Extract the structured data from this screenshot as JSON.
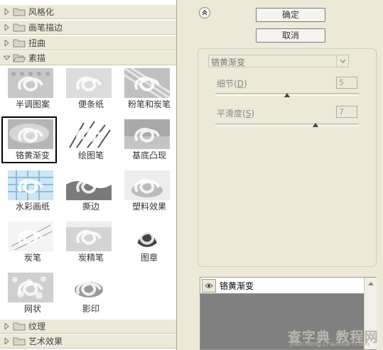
{
  "filter_browser": {
    "folders_top": [
      {
        "label": "风格化",
        "expanded": false
      },
      {
        "label": "画笔描边",
        "expanded": false
      },
      {
        "label": "扭曲",
        "expanded": false
      },
      {
        "label": "素描",
        "expanded": true
      }
    ],
    "thumbnails": [
      {
        "label": "半调图案",
        "selected": false
      },
      {
        "label": "便条纸",
        "selected": false
      },
      {
        "label": "粉笔和炭笔",
        "selected": false
      },
      {
        "label": "铬黄渐变",
        "selected": true
      },
      {
        "label": "绘图笔",
        "selected": false
      },
      {
        "label": "基底凸现",
        "selected": false
      },
      {
        "label": "水彩画纸",
        "selected": false
      },
      {
        "label": "撕边",
        "selected": false
      },
      {
        "label": "塑料效果",
        "selected": false
      },
      {
        "label": "炭笔",
        "selected": false
      },
      {
        "label": "炭精笔",
        "selected": false
      },
      {
        "label": "图章",
        "selected": false
      },
      {
        "label": "网状",
        "selected": false
      },
      {
        "label": "影印",
        "selected": false
      }
    ],
    "folders_bottom": [
      {
        "label": "纹理",
        "expanded": false
      },
      {
        "label": "艺术效果",
        "expanded": false
      }
    ]
  },
  "buttons": {
    "ok": "确定",
    "cancel": "取消"
  },
  "settings": {
    "filter_name": "铬黄渐变",
    "detail": {
      "label": "细节",
      "shortcut": "D",
      "value": "5",
      "fraction": 0.5
    },
    "smoothness": {
      "label": "平滑度",
      "shortcut": "S",
      "value": "7",
      "fraction": 0.7
    }
  },
  "layers": {
    "effect_name": "铬黄渐变"
  },
  "watermark": {
    "line1": "查字典 教程网",
    "line2": "jiaocheng.chazidian.com"
  },
  "icons": {
    "collapse": "double-chevron-up-icon",
    "folder": "folder-icon",
    "eye": "eye-icon"
  }
}
